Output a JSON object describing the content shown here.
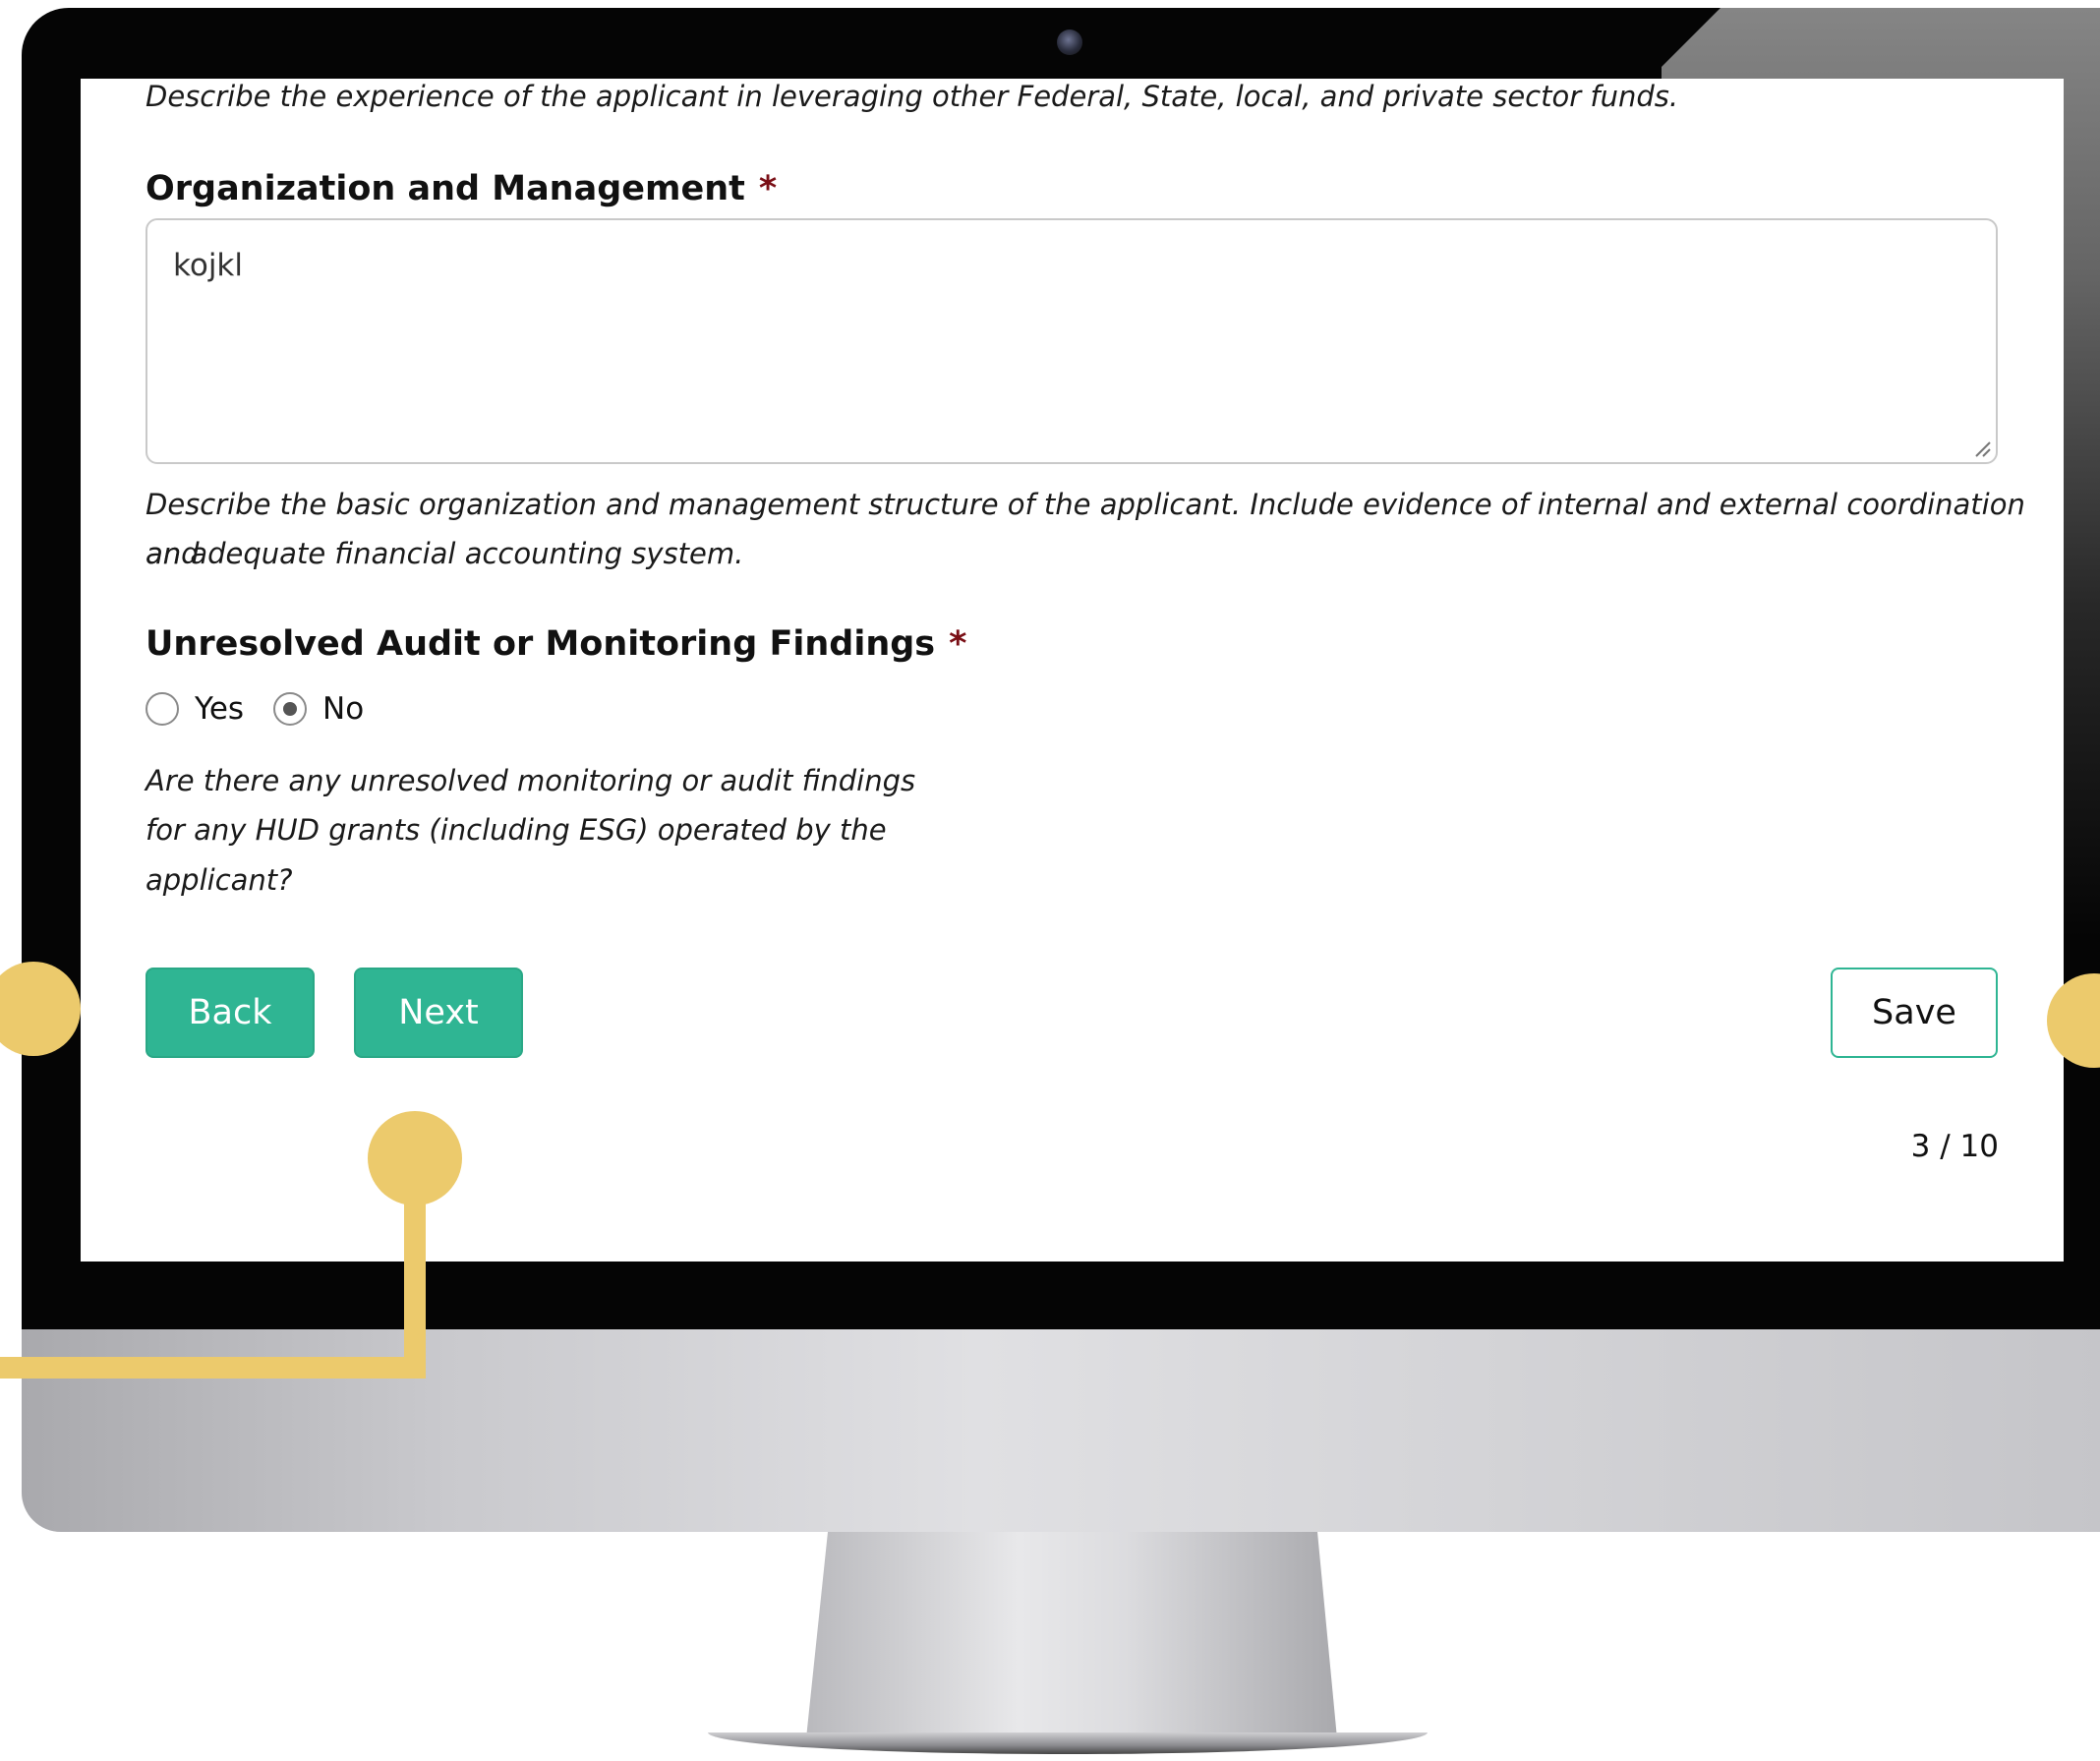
{
  "form": {
    "prev_hint": "Describe the experience of the applicant in leveraging other Federal, State, local, and private sector funds.",
    "org_mgmt": {
      "label": "Organization and Management",
      "required_marker": "*",
      "value": "kojkl",
      "hint_line1": "Describe the basic organization and management structure of the applicant. Include evidence of internal and external coordination and",
      "hint_line2": "an adequate financial accounting system."
    },
    "audit": {
      "label": "Unresolved Audit or Monitoring Findings",
      "required_marker": "*",
      "options": [
        "Yes",
        "No"
      ],
      "selected": "No",
      "hint_line1": "Are there any unresolved monitoring or audit findings",
      "hint_line2": "for any HUD grants (including ESG) operated by the",
      "hint_line3": "applicant?"
    }
  },
  "buttons": {
    "back": "Back",
    "next": "Next",
    "save": "Save"
  },
  "pagination": {
    "text": "3 / 10"
  },
  "colors": {
    "accent": "#2fb593",
    "required": "#7a0f16",
    "callout": "#ecca6c"
  }
}
